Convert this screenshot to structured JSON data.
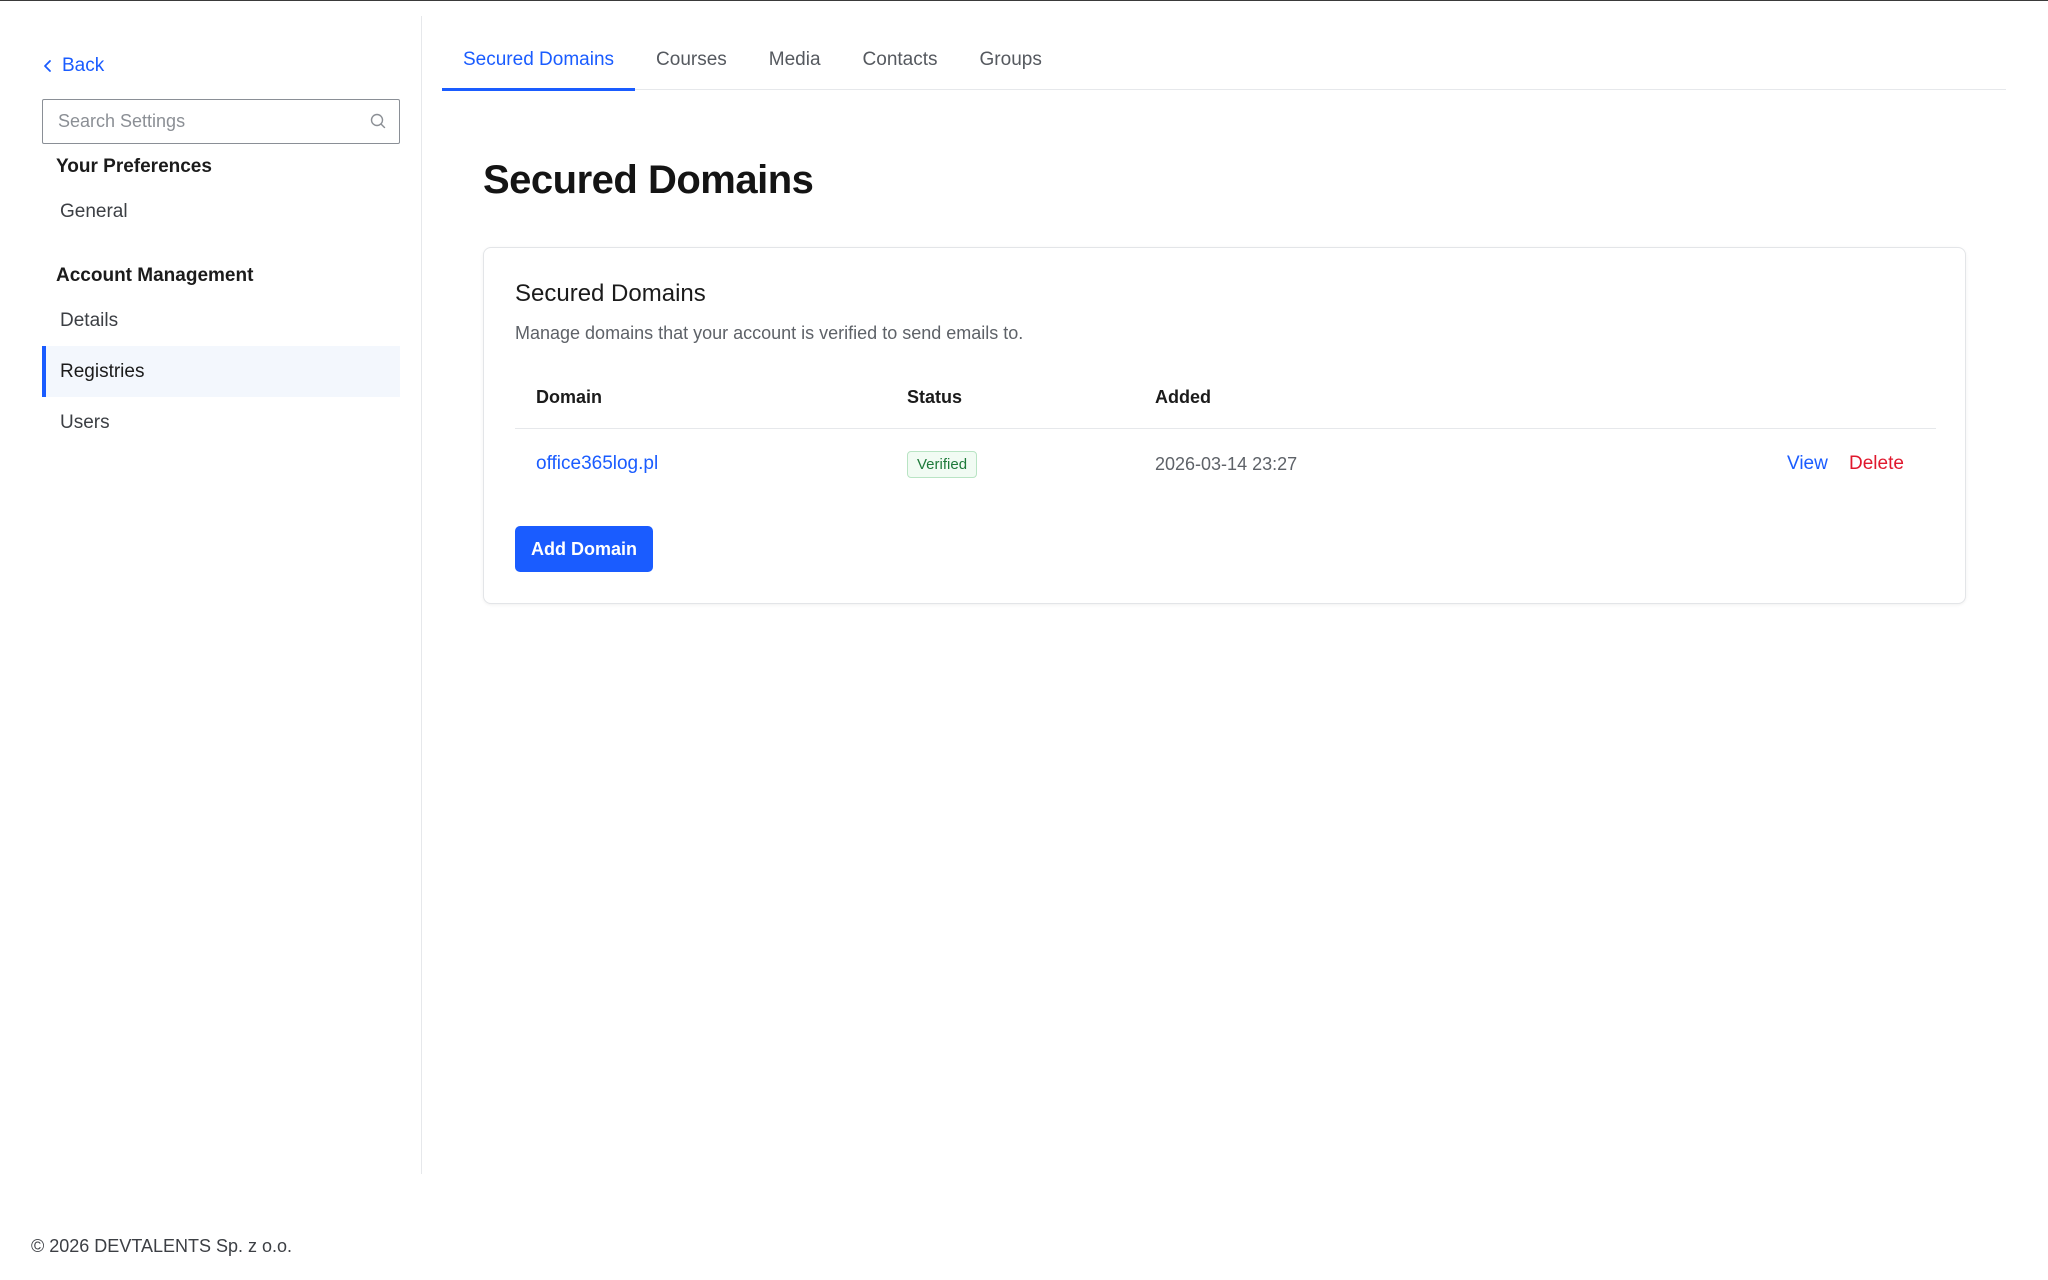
{
  "sidebar": {
    "back_label": "Back",
    "search_placeholder": "Search Settings",
    "sections": [
      {
        "title": "Your Preferences",
        "items": [
          {
            "label": "General"
          }
        ]
      },
      {
        "title": "Account Management",
        "items": [
          {
            "label": "Details"
          },
          {
            "label": "Registries",
            "active": true
          },
          {
            "label": "Users"
          }
        ]
      }
    ]
  },
  "tabs": [
    {
      "label": "Secured Domains",
      "active": true
    },
    {
      "label": "Courses"
    },
    {
      "label": "Media"
    },
    {
      "label": "Contacts"
    },
    {
      "label": "Groups"
    }
  ],
  "main": {
    "page_title": "Secured Domains",
    "card": {
      "title": "Secured Domains",
      "description": "Manage domains that your account is verified to send emails to.",
      "columns": [
        "Domain",
        "Status",
        "Added"
      ],
      "rows": [
        {
          "domain": "office365log.pl",
          "status": "Verified",
          "added": "2026-03-14 23:27",
          "view_label": "View",
          "delete_label": "Delete"
        }
      ],
      "add_button": "Add Domain"
    }
  },
  "footer": {
    "text": "© 2026 DEVTALENTS Sp. z o.o."
  },
  "colors": {
    "accent": "#1a5cff",
    "danger": "#e0182d",
    "success": "#1e7a3a"
  },
  "icons": {
    "back": "chevron-left-icon",
    "search": "search-icon"
  }
}
